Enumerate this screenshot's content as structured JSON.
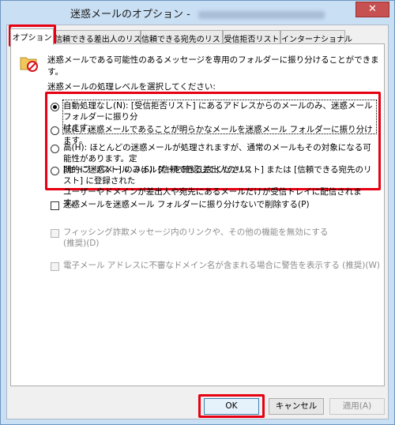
{
  "window": {
    "title": "迷惑メールのオプション - ",
    "close_glyph": "✕"
  },
  "tabs": [
    {
      "label": "オプション"
    },
    {
      "label": "信頼できる差出人のリスト"
    },
    {
      "label": "信頼できる宛先のリスト"
    },
    {
      "label": "受信拒否リスト"
    },
    {
      "label": "インターナショナル"
    }
  ],
  "options": {
    "intro": "迷惑メールである可能性のあるメッセージを専用のフォルダーに振り分けることができます。",
    "level_label": "迷惑メールの処理レベルを選択してください:",
    "levels": [
      {
        "line1": "自動処理なし(N): [受信拒否リスト] にあるアドレスからのメールのみ、迷惑メール フォルダーに振り分",
        "line2": "けます。",
        "checked": true
      },
      {
        "line1": "低(L): 迷惑メールであることが明らかなメールを迷惑メール フォルダーに振り分けます。",
        "line2": "",
        "checked": false
      },
      {
        "line1": "高(H): ほとんどの迷惑メールが処理されますが、通常のメールもその対象になる可能性があります。定",
        "line2": "期的に迷惑メール フォルダーを確認してください。",
        "checked": false
      },
      {
        "line1": "[セーフ リスト] のみ(S): [信頼できる差出人のリスト] または [信頼できる宛先のリスト] に登録された",
        "line2": "ユーザーやドメインが差出人や宛先にあるメールだけが受信トレイに配信されます。",
        "checked": false
      }
    ],
    "delete_junk": "迷惑メールを迷惑メール フォルダーに振り分けないで削除する(P)",
    "phishing_line1": "フィッシング詐欺メッセージ内のリンクや、その他の機能を無効にする",
    "phishing_line2": "(推奨)(D)",
    "domain_warn": "電子メール アドレスに不審なドメイン名が含まれる場合に警告を表示する (推奨)(W)"
  },
  "buttons": {
    "ok": "OK",
    "cancel": "キャンセル",
    "apply": "適用(A)"
  },
  "highlight_color": "#e60012"
}
